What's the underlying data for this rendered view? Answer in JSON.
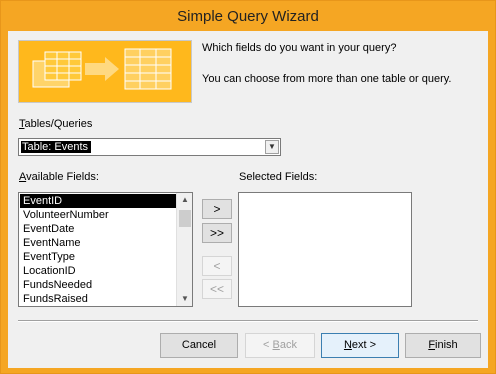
{
  "window": {
    "title": "Simple Query Wizard"
  },
  "intro": {
    "line1": "Which fields do you want in your query?",
    "line2": "You can choose from more than one table or query."
  },
  "tables_queries": {
    "label_accel": "T",
    "label_rest": "ables/Queries",
    "selected_value": "Table: Events"
  },
  "available_fields": {
    "label_accel": "A",
    "label_rest": "vailable Fields:",
    "items": [
      "EventID",
      "VolunteerNumber",
      "EventDate",
      "EventName",
      "EventType",
      "LocationID",
      "FundsNeeded",
      "FundsRaised"
    ],
    "selected_index": 0
  },
  "selected_fields": {
    "label": "Selected Fields:",
    "items": []
  },
  "move_buttons": {
    "add_one": ">",
    "add_all": ">>",
    "remove_one": "<",
    "remove_all": "<<"
  },
  "footer": {
    "cancel": "Cancel",
    "back_accel": "B",
    "back_pre": "< ",
    "back_rest": "ack",
    "next_accel": "N",
    "next_rest": "ext >",
    "finish_accel": "F",
    "finish_rest": "inish"
  },
  "colors": {
    "title_bar": "#f5a623",
    "dialog_bg": "#f0f0f0",
    "selection": "#000000"
  }
}
